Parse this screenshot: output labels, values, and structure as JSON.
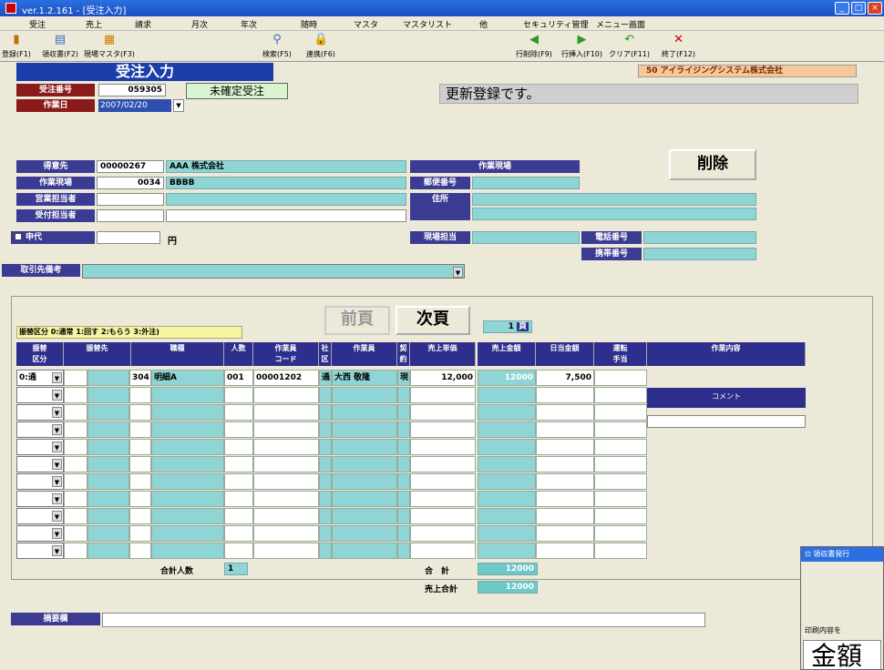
{
  "window": {
    "title": "ver.1.2.161 - [受注入力]"
  },
  "menu": [
    "受注",
    "売上",
    "請求",
    "月次",
    "年次",
    "随時",
    "マスタ",
    "マスタリスト",
    "他",
    "セキュリティ管理",
    "メニュー画面"
  ],
  "toolbar": [
    {
      "label": "登録(F1)",
      "icon": "save-icon",
      "color": "#c07000"
    },
    {
      "label": "領収書(F2)",
      "icon": "receipt-icon",
      "color": "#3b6fc4"
    },
    {
      "label": "現場マスタ(F3)",
      "icon": "site-master-icon",
      "color": "#d08000"
    },
    {
      "label": "検索(F5)",
      "icon": "search-icon",
      "color": "#3b6fc4"
    },
    {
      "label": "連携(F6)",
      "icon": "link-icon",
      "color": "#c9a000"
    },
    {
      "label": "行削除(F9)",
      "icon": "row-delete-icon",
      "color": "#2a9a2a"
    },
    {
      "label": "行挿入(F10)",
      "icon": "row-insert-icon",
      "color": "#2a9a2a"
    },
    {
      "label": "クリア(F11)",
      "icon": "clear-icon",
      "color": "#2a9a2a"
    },
    {
      "label": "終了(F12)",
      "icon": "exit-icon",
      "color": "#c00000"
    }
  ],
  "form": {
    "screen_title": "受注入力",
    "company": "50 アイライジングシステム株式会社",
    "order_no_label": "受注番号",
    "order_no": "059305",
    "status": "未確定受注",
    "message": "更新登録です。",
    "work_date_label": "作業日",
    "work_date": "2007/02/20",
    "customer_label": "得意先",
    "customer_code": "00000267",
    "customer_name": "AAA 株式会社",
    "site_label": "作業現場",
    "site_code": "0034",
    "site_name": "BBBB",
    "sales_staff_label": "営業担当者",
    "reception_staff_label": "受付担当者",
    "proxy_label": "申代",
    "yen": "円",
    "trade_note_label": "取引先備考",
    "site_box_title": "作業現場",
    "postal_label": "郵便番号",
    "address_label": "住所",
    "site_person_label": "現場担当",
    "phone_label": "電話番号",
    "mobile_label": "携帯番号",
    "delete_label": "削除"
  },
  "grid": {
    "legend": "振替区分 0:通常 1:回す 2:もらう 3:外注)",
    "prev_label": "前頁",
    "next_label": "次頁",
    "page": "1",
    "page_unit": "頁",
    "headers": [
      "振替\n区分",
      "振替先",
      "職種",
      "人数",
      "作業員\nコード",
      "社\n区",
      "作業員",
      "契\n約",
      "売上単価",
      "売上金額",
      "日当金額",
      "運転\n手当",
      "作業内容"
    ],
    "first_row": {
      "kubun": "0:通",
      "code": "304",
      "job": "明細A",
      "ninzu": "001",
      "worker_code": "00001202",
      "sha": "通",
      "worker": "大西 敬隆",
      "kei": "現",
      "unit": "12,000",
      "amount": "12000",
      "daily": "7,500"
    },
    "comment_label": "コメント",
    "total_people_label": "合計人数",
    "total_people": "1",
    "total_label": "合　計",
    "total": "12000",
    "sales_total_label": "売上合計",
    "sales_total": "12000"
  },
  "remarks_label": "摘要欄",
  "popup": {
    "title": "領収書発行",
    "label": "印刷内容を",
    "big": "金額"
  }
}
